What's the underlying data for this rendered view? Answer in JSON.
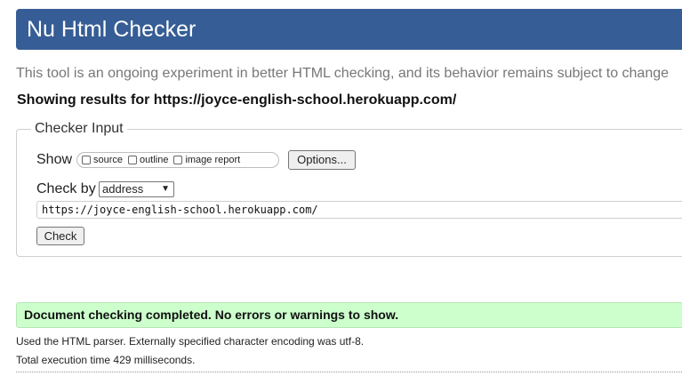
{
  "header": {
    "title": "Nu Html Checker"
  },
  "tagline": "This tool is an ongoing experiment in better HTML checking, and its behavior remains subject to change",
  "showing_results": "Showing results for https://joyce-english-school.herokuapp.com/",
  "checker_input": {
    "legend": "Checker Input",
    "show_label": "Show",
    "show_options": [
      {
        "label": "source",
        "checked": false
      },
      {
        "label": "outline",
        "checked": false
      },
      {
        "label": "image report",
        "checked": false
      }
    ],
    "options_button": "Options...",
    "check_by_label": "Check by",
    "check_by_selected": "address",
    "url_value": "https://joyce-english-school.herokuapp.com/",
    "check_button": "Check"
  },
  "result": {
    "message": "Document checking completed. No errors or warnings to show.",
    "parser_info": "Used the HTML parser. Externally specified character encoding was utf-8.",
    "execution_time": "Total execution time 429 milliseconds."
  },
  "colors": {
    "header_bg": "#365d95",
    "success_bg": "#ccffcc"
  }
}
